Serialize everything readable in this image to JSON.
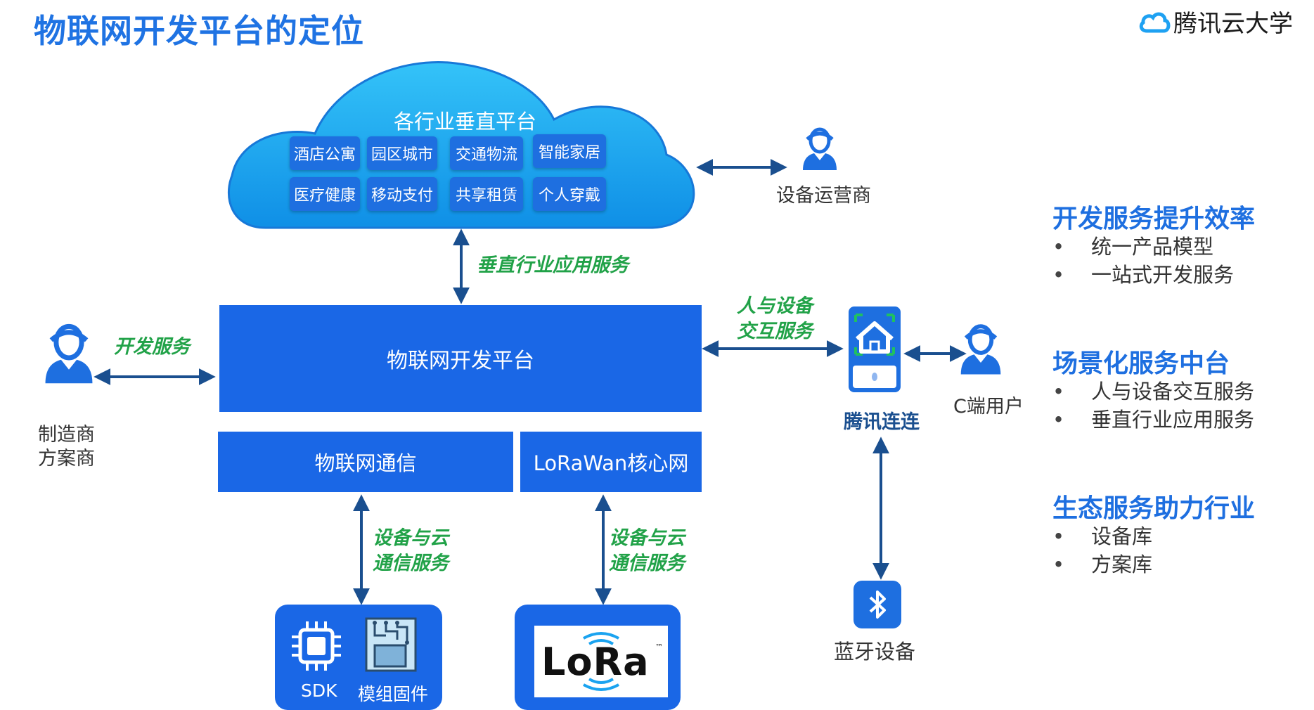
{
  "title": "物联网开发平台的定位",
  "brand": "腾讯云大学",
  "cloud": {
    "title": "各行业垂直平台",
    "chips": [
      "酒店公寓",
      "园区城市",
      "交通物流",
      "智能家居",
      "医疗健康",
      "移动支付",
      "共享租赁",
      "个人穿戴"
    ]
  },
  "platform": {
    "main": "物联网开发平台",
    "comm": "物联网通信",
    "lora_core": "LoRaWan核心网"
  },
  "edges": {
    "vertical_service": "垂直行业应用服务",
    "dev_service": "开发服务",
    "human_device": [
      "人与设备",
      "交互服务"
    ],
    "device_cloud_1": [
      "设备与云",
      "通信服务"
    ],
    "device_cloud_2": [
      "设备与云",
      "通信服务"
    ]
  },
  "actors": {
    "operator": "设备运营商",
    "manufacturer": [
      "制造商",
      "方案商"
    ],
    "c_user": "C端用户"
  },
  "devices": {
    "sdk": "SDK",
    "module": "模组固件",
    "lora_logo": "LoRa",
    "tm": "™",
    "tencent_lianlian": "腾讯连连",
    "bluetooth": "蓝牙设备"
  },
  "features": [
    {
      "title": "开发服务提升效率",
      "items": [
        "统一产品模型",
        "一站式开发服务"
      ]
    },
    {
      "title": "场景化服务中台",
      "items": [
        "人与设备交互服务",
        "垂直行业应用服务"
      ]
    },
    {
      "title": "生态服务助力行业",
      "items": [
        "设备库",
        "方案库"
      ]
    }
  ],
  "colors": {
    "accent": "#1f73e3",
    "green": "#21a248",
    "cloud": "#1aa3f0",
    "box": "#1a67e6",
    "navy": "#1a4f8f"
  }
}
